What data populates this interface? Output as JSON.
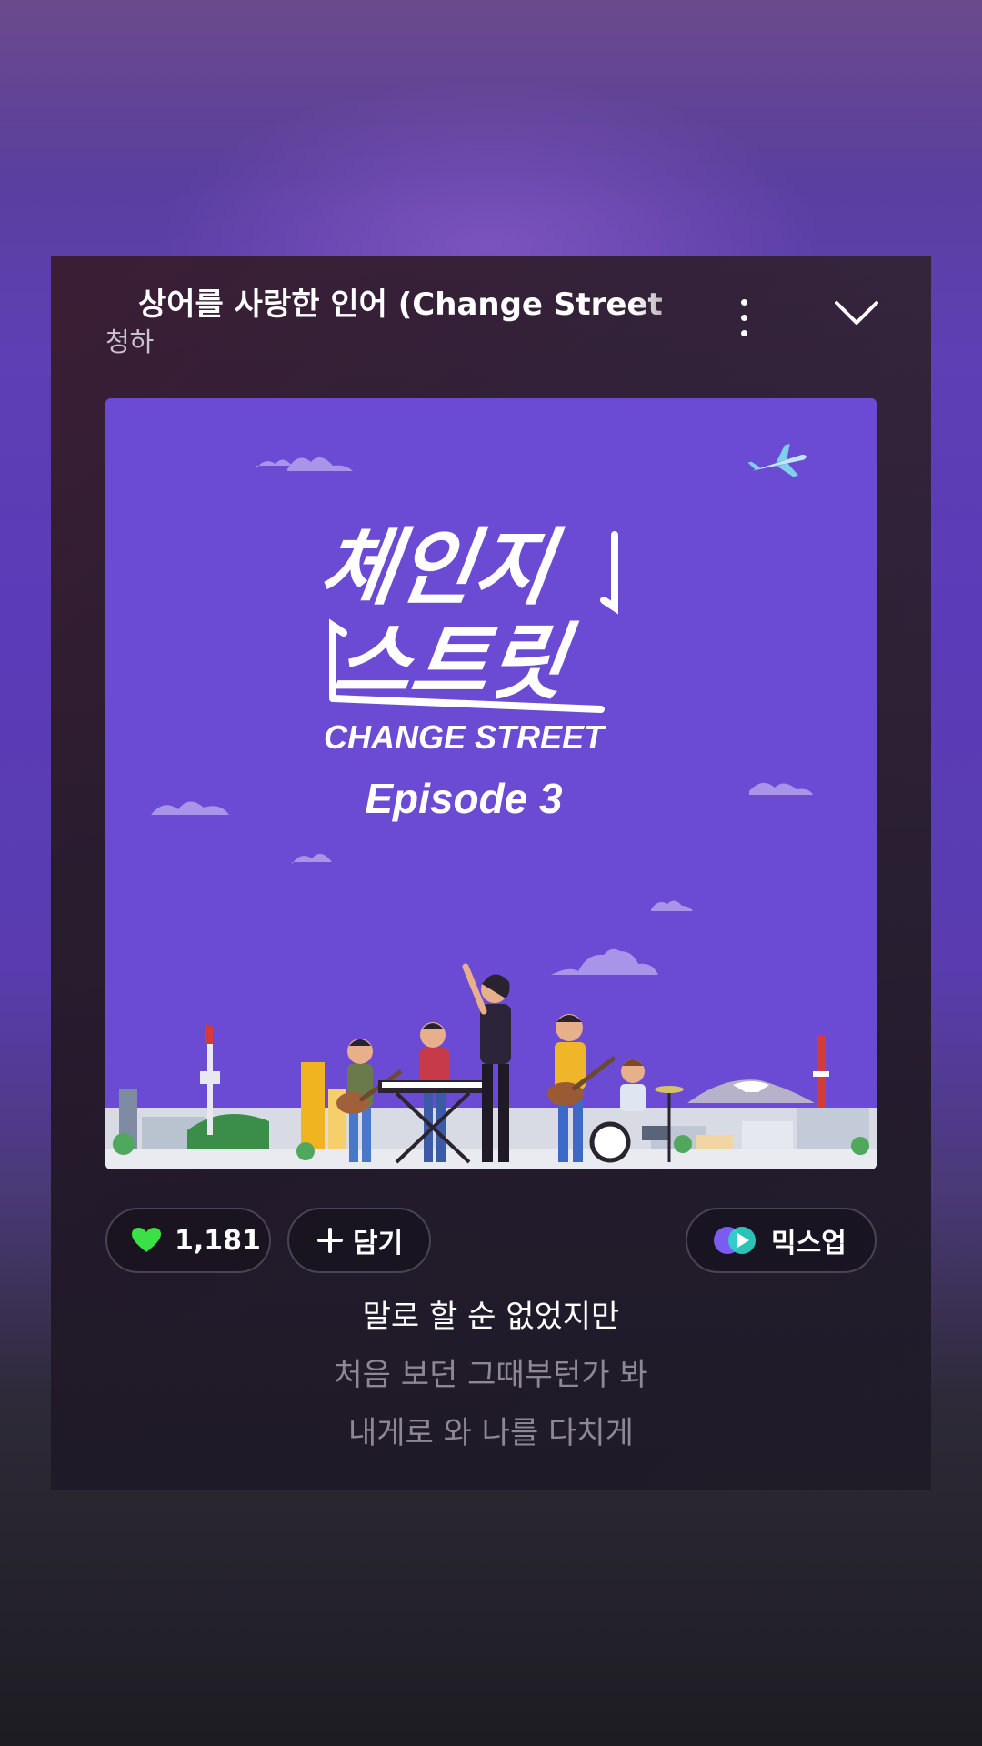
{
  "player": {
    "song_title": "상어를 사랑한 인어 (Change Street",
    "artist": "청하",
    "more_icon": "more-vertical-icon",
    "collapse_icon": "chevron-down-icon"
  },
  "album_art": {
    "logo_korean_line1": "체인지",
    "logo_korean_line2": "스트릿",
    "logo_english": "CHANGE STREET",
    "episode": "Episode 3",
    "background_color": "#6b4bd4"
  },
  "actions": {
    "like_count": "1,181",
    "like_icon": "heart-icon",
    "like_color": "#39e046",
    "add_label": "담기",
    "add_icon": "plus-icon",
    "mixup_label": "믹스업",
    "mixup_icon": "mixup-icon"
  },
  "lyrics": {
    "current": "말로 할 순 없었지만",
    "next1": "처음 보던 그때부턴가 봐",
    "next2": "내게로 와 나를 다치게"
  }
}
